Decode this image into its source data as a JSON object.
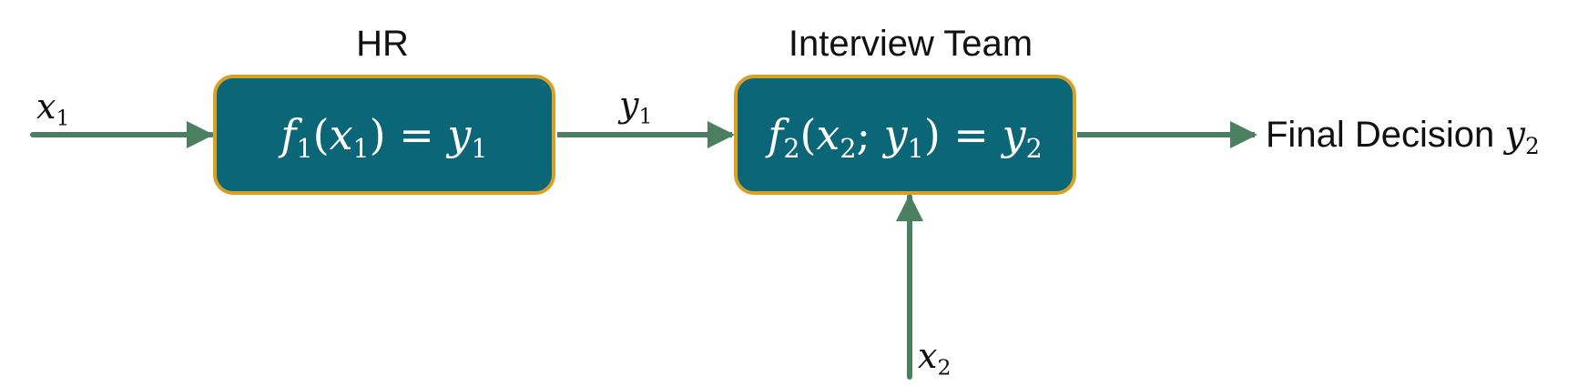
{
  "colors": {
    "box_fill": "#0b6677",
    "box_border": "#d9a028",
    "arrow": "#4a8060",
    "text": "#111111",
    "box_text": "#ffffff"
  },
  "nodes": {
    "hr": {
      "title": "HR",
      "fn_name": "f",
      "fn_sub": "1",
      "arg": "x",
      "arg_sub": "1",
      "equals": "=",
      "out": "y",
      "out_sub": "1"
    },
    "interview": {
      "title": "Interview Team",
      "fn_name": "f",
      "fn_sub": "2",
      "arg1": "x",
      "arg1_sub": "2",
      "separator": ";",
      "arg2": "y",
      "arg2_sub": "1",
      "equals": "=",
      "out": "y",
      "out_sub": "2"
    }
  },
  "inputs": {
    "x1": {
      "symbol": "x",
      "sub": "1"
    },
    "y1": {
      "symbol": "y",
      "sub": "1"
    },
    "x2": {
      "symbol": "x",
      "sub": "2"
    }
  },
  "output": {
    "label": "Final Decision",
    "symbol": "y",
    "sub": "2"
  }
}
